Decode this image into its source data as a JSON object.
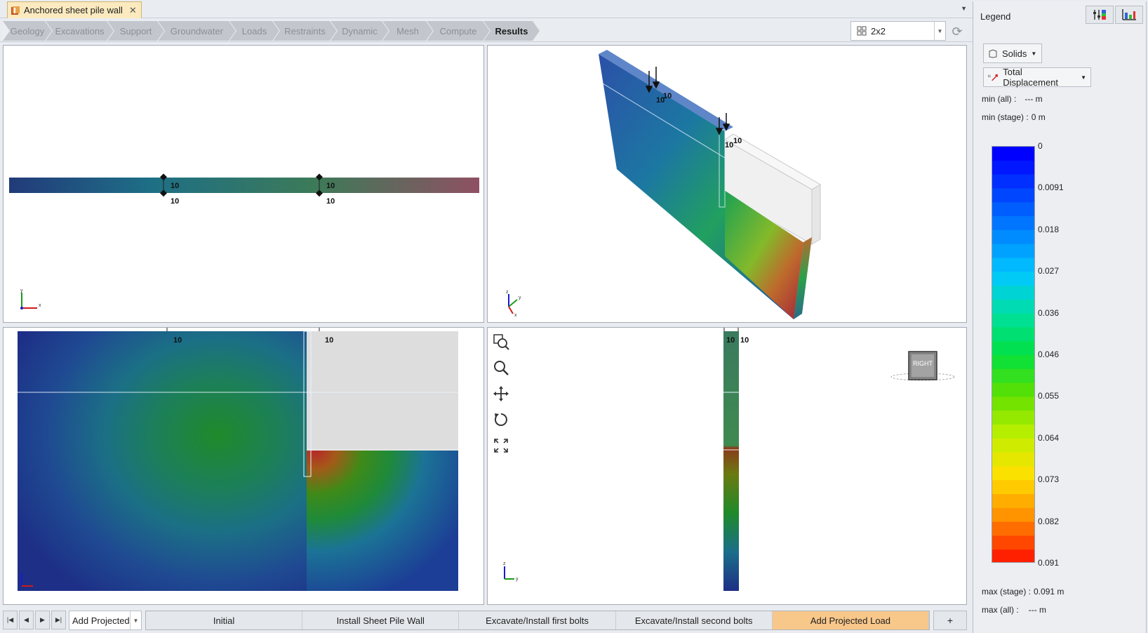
{
  "document_tab": {
    "title": "Anchored sheet pile wall",
    "close": "✕"
  },
  "workflow": {
    "steps": [
      "Geology",
      "Excavations",
      "Support",
      "Groundwater",
      "Loads",
      "Restraints",
      "Dynamic",
      "Mesh",
      "Compute",
      "Results"
    ],
    "active": "Results"
  },
  "layout_select": {
    "value": "2x2"
  },
  "viewports": {
    "labels": [
      "10",
      "10",
      "10",
      "10",
      "10",
      "10",
      "10",
      "10",
      "10",
      "10",
      "10",
      "10",
      "10",
      "10"
    ],
    "view_cube_label": "RIGHT",
    "axes": {
      "x": "x",
      "y": "y",
      "z": "z"
    }
  },
  "stage_bar": {
    "selector_value": "Add Projected",
    "stages": [
      "Initial",
      "Install Sheet Pile Wall",
      "Excavate/Install first bolts",
      "Excavate/Install second bolts",
      "Add Projected Load"
    ],
    "active_stage": "Add Projected Load",
    "add_label": "+"
  },
  "legend": {
    "title": "Legend",
    "body_type": "Solids",
    "result_type": "Total Displacement",
    "min_all_label": "min (all) :",
    "min_all_value": "--- m",
    "min_stage_label": "min (stage) :",
    "min_stage_value": "0 m",
    "max_stage_label": "max (stage) :",
    "max_stage_value": "0.091 m",
    "max_all_label": "max (all) :",
    "max_all_value": "--- m",
    "ticks": [
      "0",
      "0.0091",
      "0.018",
      "0.027",
      "0.036",
      "0.046",
      "0.055",
      "0.064",
      "0.073",
      "0.082",
      "0.091"
    ],
    "colors": [
      "#0000ff",
      "#0044ff",
      "#0088ff",
      "#00c8ff",
      "#00e0a0",
      "#00e040",
      "#60e000",
      "#c0f000",
      "#ffe000",
      "#ff9000",
      "#ff2000"
    ]
  },
  "icons": [
    "sheet-pile-document-icon",
    "layout-grid-icon",
    "refresh-icon",
    "zoom-box-icon",
    "zoom-icon",
    "pan-icon",
    "rotate-icon",
    "fit-extents-icon",
    "legend-settings-icon",
    "chart-icon",
    "solids-icon",
    "displacement-icon"
  ]
}
